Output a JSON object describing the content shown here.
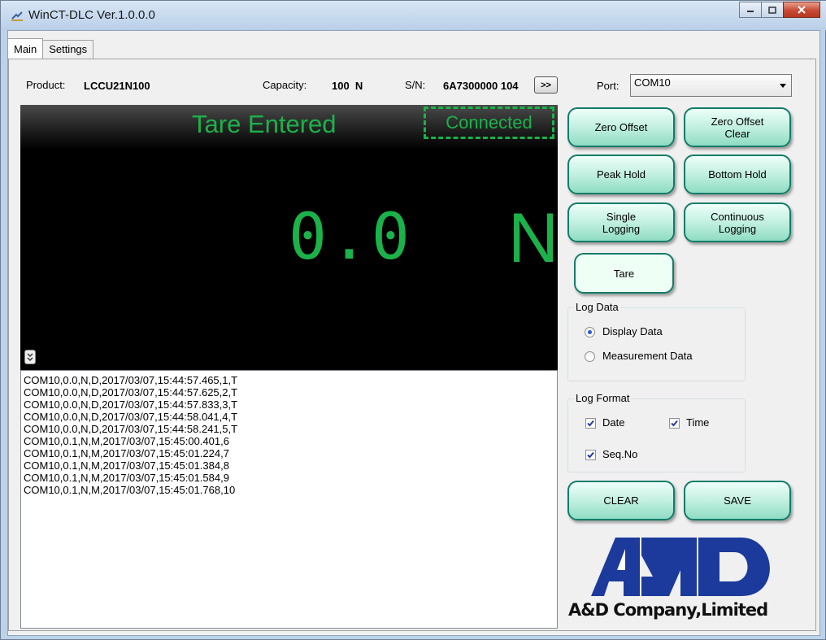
{
  "window": {
    "title": "WinCT-DLC Ver.1.0.0.0"
  },
  "tabs": [
    {
      "label": "Main"
    },
    {
      "label": "Settings"
    }
  ],
  "info": {
    "product_label": "Product:",
    "product_value": "LCCU21N100",
    "capacity_label": "Capacity:",
    "capacity_value": "100  N",
    "sn_label": "S/N:",
    "sn_value": "6A7300000 104",
    "forward_button": ">>"
  },
  "display": {
    "status": "Tare Entered",
    "connection": "Connected",
    "reading": "0.0",
    "unit": "N",
    "expand_icon": "chevron-double-down-icon"
  },
  "log_lines": [
    "COM10,0.0,N,D,2017/03/07,15:44:57.465,1,T",
    "COM10,0.0,N,D,2017/03/07,15:44:57.625,2,T",
    "COM10,0.0,N,D,2017/03/07,15:44:57.833,3,T",
    "COM10,0.0,N,D,2017/03/07,15:44:58.041,4,T",
    "COM10,0.0,N,D,2017/03/07,15:44:58.241,5,T",
    "COM10,0.1,N,M,2017/03/07,15:45:00.401,6",
    "COM10,0.1,N,M,2017/03/07,15:45:01.224,7",
    "COM10,0.1,N,M,2017/03/07,15:45:01.384,8",
    "COM10,0.1,N,M,2017/03/07,15:45:01.584,9",
    "COM10,0.1,N,M,2017/03/07,15:45:01.768,10"
  ],
  "port": {
    "label": "Port:",
    "value": "COM10"
  },
  "buttons": {
    "zero_offset": "Zero Offset",
    "zero_offset_clear_1": "Zero Offset",
    "zero_offset_clear_2": "Clear",
    "peak_hold": "Peak Hold",
    "bottom_hold": "Bottom Hold",
    "single_logging_1": "Single",
    "single_logging_2": "Logging",
    "continuous_logging_1": "Continuous",
    "continuous_logging_2": "Logging",
    "tare": "Tare",
    "clear": "CLEAR",
    "save": "SAVE"
  },
  "log_data": {
    "title": "Log Data",
    "options": [
      {
        "label": "Display Data",
        "selected": true
      },
      {
        "label": "Measurement Data",
        "selected": false
      }
    ]
  },
  "log_format": {
    "title": "Log Format",
    "date": {
      "label": "Date",
      "checked": true
    },
    "time": {
      "label": "Time",
      "checked": true
    },
    "seq": {
      "label": "Seq.No",
      "checked": true
    }
  },
  "logo": {
    "text": "A&D Company,Limited",
    "brand_color": "#1b3a9c"
  },
  "colors": {
    "display_green": "#1bb24a",
    "button_border": "#127c68"
  }
}
